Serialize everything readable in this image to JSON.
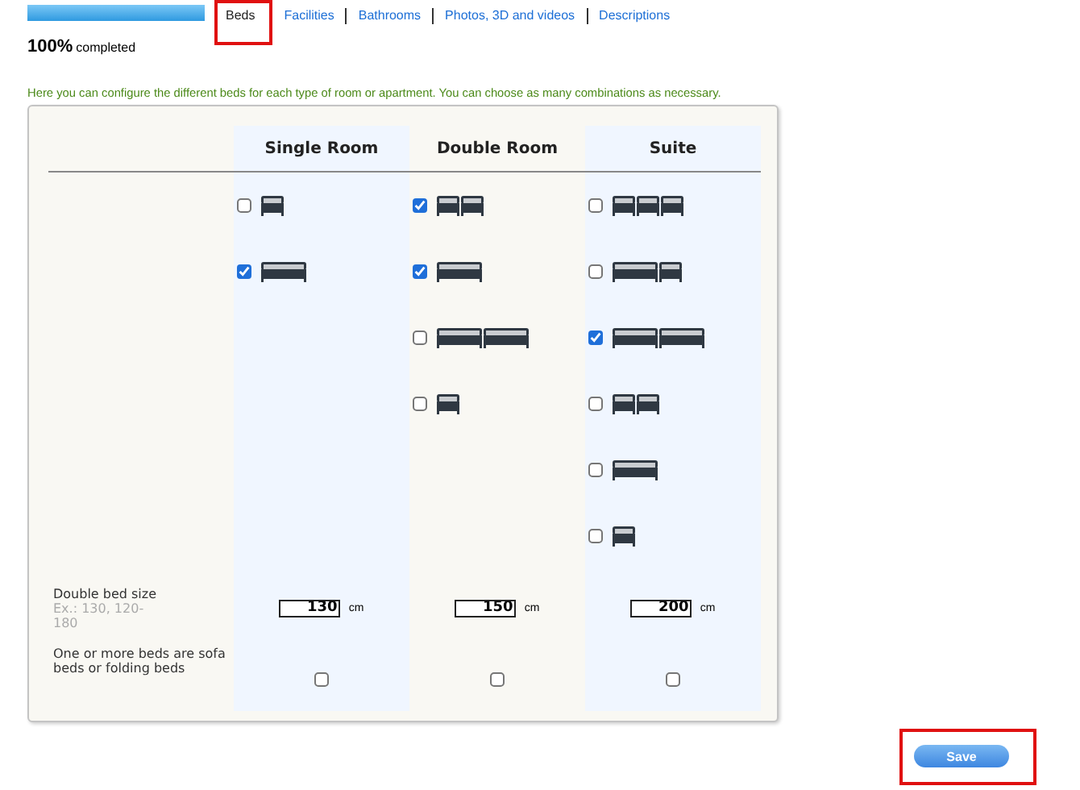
{
  "progress": {
    "level": 1,
    "percent": "100%",
    "caption": "completed"
  },
  "tabs": [
    {
      "label": "Beds",
      "selected": true,
      "highlighted": true
    },
    {
      "label": "Facilities",
      "selected": false,
      "highlighted": false
    },
    {
      "label": "Bathrooms",
      "selected": false,
      "highlighted": false
    },
    {
      "label": "Photos, 3D and videos",
      "selected": false,
      "highlighted": false
    },
    {
      "label": "Descriptions",
      "selected": false,
      "highlighted": false
    }
  ],
  "intro": "Here you can configure the different beds for each type of room or apartment. You can choose as many combinations as necessary.",
  "rooms": [
    {
      "name": "Single Room",
      "bed_size": "130",
      "unit": "cm",
      "sofa_beds": false,
      "options": [
        {
          "beds": [
            {
              "kind": "single"
            }
          ],
          "checked": false
        },
        {
          "beds": [
            {
              "kind": "double"
            }
          ],
          "checked": true
        }
      ]
    },
    {
      "name": "Double Room",
      "bed_size": "150",
      "unit": "cm",
      "sofa_beds": false,
      "options": [
        {
          "beds": [
            {
              "kind": "single"
            },
            {
              "kind": "single"
            }
          ],
          "checked": true
        },
        {
          "beds": [
            {
              "kind": "double"
            }
          ],
          "checked": true
        },
        {
          "beds": [
            {
              "kind": "double"
            },
            {
              "kind": "double"
            }
          ],
          "checked": false
        },
        {
          "beds": [
            {
              "kind": "single"
            }
          ],
          "checked": false
        }
      ]
    },
    {
      "name": "Suite",
      "bed_size": "200",
      "unit": "cm",
      "sofa_beds": false,
      "options": [
        {
          "beds": [
            {
              "kind": "single"
            },
            {
              "kind": "single"
            },
            {
              "kind": "single"
            }
          ],
          "checked": false
        },
        {
          "beds": [
            {
              "kind": "double"
            },
            {
              "kind": "single"
            }
          ],
          "checked": false
        },
        {
          "beds": [
            {
              "kind": "double"
            },
            {
              "kind": "double"
            }
          ],
          "checked": true
        },
        {
          "beds": [
            {
              "kind": "single"
            },
            {
              "kind": "single"
            }
          ],
          "checked": false
        },
        {
          "beds": [
            {
              "kind": "double"
            }
          ],
          "checked": false
        },
        {
          "beds": [
            {
              "kind": "single"
            }
          ],
          "checked": false
        }
      ]
    }
  ],
  "size_label": "Double bed size",
  "size_hint": "Ex.: 130, 120-180",
  "sofa_label": "One or more beds are sofa beds or folding beds",
  "save": {
    "label": "Save",
    "highlighted": true
  }
}
